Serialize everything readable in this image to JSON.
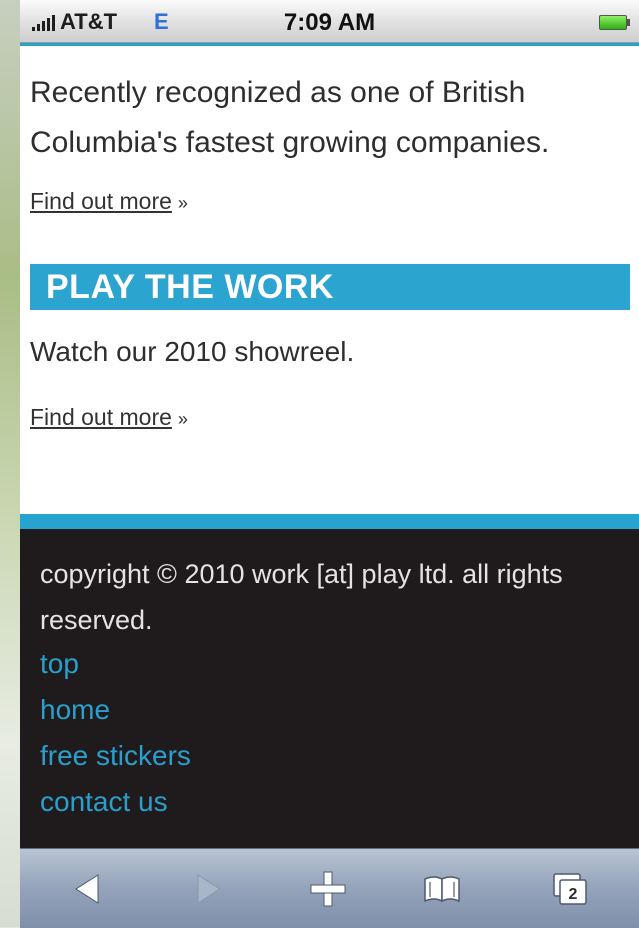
{
  "status_bar": {
    "carrier": "AT&T",
    "network": "E",
    "time": "7:09 AM"
  },
  "intro": {
    "text": "Recently recognized as one of British Columbia's fastest growing companies.",
    "link": "Find out more",
    "link_suffix": "»"
  },
  "section": {
    "title": "PLAY THE WORK",
    "text": "Watch our 2010 showreel.",
    "link": "Find out more",
    "link_suffix": "»"
  },
  "footer": {
    "copyright": "copyright © 2010 work [at] play ltd. all rights reserved.",
    "links": [
      "top",
      "home",
      "free stickers",
      "contact us"
    ]
  },
  "toolbar": {
    "tabs_count": "2",
    "icons": [
      "back-icon",
      "forward-icon",
      "add-icon",
      "bookmarks-icon",
      "pages-icon"
    ]
  },
  "colors": {
    "accent": "#27a3cf",
    "footer_bg": "#1f1b1d",
    "link": "#2a9fcc"
  }
}
